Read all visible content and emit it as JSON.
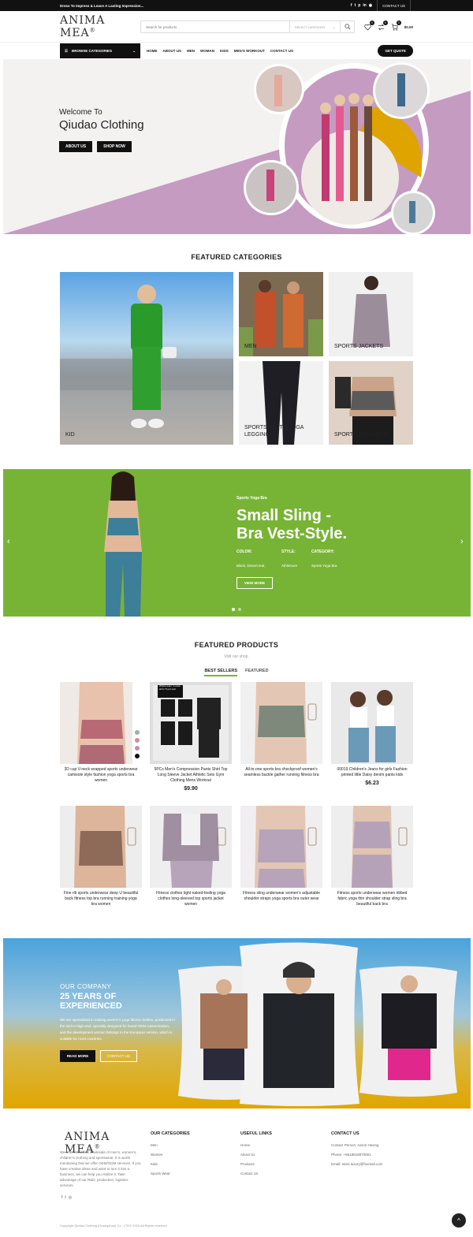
{
  "topbar": {
    "tagline": "Dress To Impress & Leave A Lasting Impression...",
    "social": [
      "f",
      "t",
      "p",
      "in",
      "◉"
    ],
    "contact": "CONTACT US"
  },
  "header": {
    "logo": "ANIMA MEA",
    "logo_mark": "®",
    "search_placeholder": "Search for products",
    "category_label": "SELECT CATEGORY",
    "wishlist_count": "0",
    "compare_count": "0",
    "cart_count": "0",
    "cart_total": "$0.00"
  },
  "nav": {
    "browse": "BROWSE CATEGORIES",
    "items": [
      "HOME",
      "ABOUT US",
      "MEN",
      "WOMAN",
      "KIDS",
      "MEN'S WORKOUT",
      "CONTACT US"
    ],
    "quote": "GET QUOTE"
  },
  "hero": {
    "welcome": "Welcome To",
    "brand": "Qiudao Clothing",
    "btn_about": "ABOUT US",
    "btn_shop": "SHOP NOW"
  },
  "categories": {
    "title": "FEATURED CATEGORIES",
    "items": [
      "KID",
      "MEN",
      "SPORTS JACKETS",
      "SPORTS PANTS YOGA LEGGINGS",
      "SPORTS YOGA BRA"
    ]
  },
  "banner": {
    "kicker": "Sports Yoga Bra",
    "title_1": "Small Sling -",
    "title_2": "Bra Vest-Style.",
    "color_label": "COLOR:",
    "style_label": "STYLE:",
    "category_label": "CATEGORY:",
    "color_value": "Black, Desert teal,",
    "style_value": "Athleisure",
    "category_value": "Sports Yoga Bra",
    "button": "VIEW MORE",
    "colors": {
      "bg": "#77b435"
    }
  },
  "products": {
    "title": "FEATURED PRODUCTS",
    "subtitle": "Visit our shop.",
    "tab_best": "BEST SELLERS",
    "tab_featured": "FEATURED",
    "items": [
      {
        "name": "3D cup V-neck wrapped sports underwear camisole style fashion yoga sports bra women",
        "price": ""
      },
      {
        "name": "5PCs Men's Compression Pants Shirt Top Long Sleeve Jacket Athletic Sets Gym Clothing Mens Workout",
        "price": "$9.90",
        "overlay": "Whole team / Loose shirt / 5 pcs suit"
      },
      {
        "name": "All-in-one sports bra shockproof women's seamless buckle gather running fitness bra",
        "price": ""
      },
      {
        "name": "00019 Children's Jeans for girls Fashion printed little Daisy denim pants kids",
        "price": "$6.23"
      },
      {
        "name": "Fine rib sports underwear deep U beautiful back fitness top bra running training yoga bra women",
        "price": ""
      },
      {
        "name": "Fitness clothes tight naked-feeling yoga clothes long-sleeved top sports jacket women",
        "price": ""
      },
      {
        "name": "Fitness sling underwear women's adjustable shoulder straps yoga sports bra outer wear",
        "price": ""
      },
      {
        "name": "Fitness sports underwear women ribbed fabric yoga thin shoulder strap sling bra beautiful back bra",
        "price": ""
      }
    ]
  },
  "company": {
    "kicker": "OUR COMPANY",
    "title": "25 YEARS OF EXPERIENCED",
    "body": "We are specialized in making women's yoga fitness clothes, positioned in the mid-to-high-end, specially designed for brand OEM customization, and the development version belongs to the European version, which is suitable for most countries.",
    "btn_read": "READ MORE",
    "btn_contact": "CONTACT US"
  },
  "footer": {
    "logo": "ANIMA MEA",
    "logo_mark": "®",
    "about": "We offer retail and wholesale of men's, women's, children's clothing and sportswear. It is worth mentioning that we offer OEM/ODM services. If you have creative ideas and want to turn it into a business, we can help you realize it. Take advantage of our R&D, production, logistics services.",
    "social": [
      "f",
      "t",
      "◎"
    ],
    "col1_title": "OUR CATEGORIES",
    "col1": [
      "Men",
      "Women",
      "Kids",
      "Sports Wear"
    ],
    "col2_title": "USEFUL LINKS",
    "col2": [
      "Home",
      "About Us",
      "Products",
      "Contact Us"
    ],
    "col3_title": "CONTACT US",
    "col3": [
      "Contact Person: Aaron Hwong",
      "Phone: +8618818870061",
      "Email: stars.luxury@foxmail.com"
    ],
    "copyright": "Copyright Qiudao Clothing (Guangzhou) Co., LTD© 2023 All Rights reserved",
    "to_top": "^"
  }
}
